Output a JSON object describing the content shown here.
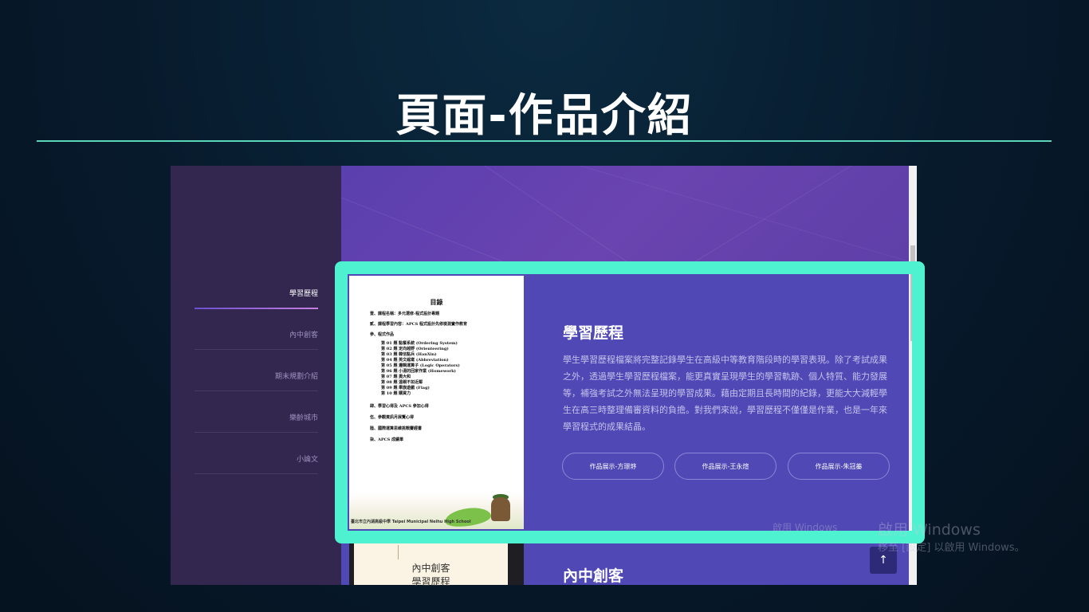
{
  "slide": {
    "title": "頁面-作品介紹"
  },
  "sidebar": {
    "items": [
      {
        "label": "學習歷程"
      },
      {
        "label": "內中創客"
      },
      {
        "label": "期末規劃介紹"
      },
      {
        "label": "樂齡城市"
      },
      {
        "label": "小論文"
      }
    ]
  },
  "document_thumb": {
    "title": "目錄",
    "lines": [
      "壹、課程名稱：多元選修-程式設計專題",
      "貳、課程學習內容：APCS 程式設計先修檢測實作教育",
      "參、程式作品",
      "第 01 題 點餐系統 (Ordering System)",
      "第 02 題 定向越野 (Orienteering)",
      "第 03 題 韓信點兵 (HanXin)",
      "第 04 題 英文縮寫 (Abbreviation)",
      "第 05 題 邏輯運算子 (Logic Operators)",
      "第 06 題 小湯的回家作業 (Homework)",
      "第 07 題 奧大和",
      "第 08 題 遠親不如近鄰",
      "第 09 題 舉旗遊戲 (Flag)",
      "第 10 題 購買力",
      "肆、學習心得及 APCS 參加心得",
      "伍、參觀資訊月展覽心得",
      "陸、國際運算思維挑戰賽經書",
      "柒、APCS 成績單"
    ],
    "footer_text": "臺北市立內湖高級中學 Taipei Municipal Neihu High School"
  },
  "section1": {
    "heading": "學習歷程",
    "body": "學生學習歷程檔案將完整記錄學生在高級中等教育階段時的學習表現。除了考試成果之外，透過學生學習歷程檔案，能更真實呈現學生的學習軌跡、個人特質、能力發展等，補強考試之外無法呈現的學習成果。藉由定期且長時間的紀錄，更能大大減輕學生在高三時整理備審資料的負擔。對我們來說，學習歷程不僅僅是作業，也是一年來學習程式的成果結晶。",
    "buttons": [
      {
        "label": "作品展示-方璟垿"
      },
      {
        "label": "作品展示-王永煊"
      },
      {
        "label": "作品展示-朱冠蓁"
      }
    ]
  },
  "section2": {
    "heading": "內中創客",
    "book_lines": [
      "內中創客",
      "學習歷程"
    ]
  },
  "back_to_top": {
    "icon": "arrow-up-icon",
    "glyph": "↑"
  },
  "watermarks": {
    "inner": "啟用 Windows",
    "outer_title": "啟用 Windows",
    "outer_sub": "移至 [設定] 以啟用 Windows。"
  },
  "colors": {
    "highlight": "#4ef2d0",
    "title_rule": "#5ad6b8",
    "panel": "#4f48b5",
    "sidebar": "#33264f"
  }
}
